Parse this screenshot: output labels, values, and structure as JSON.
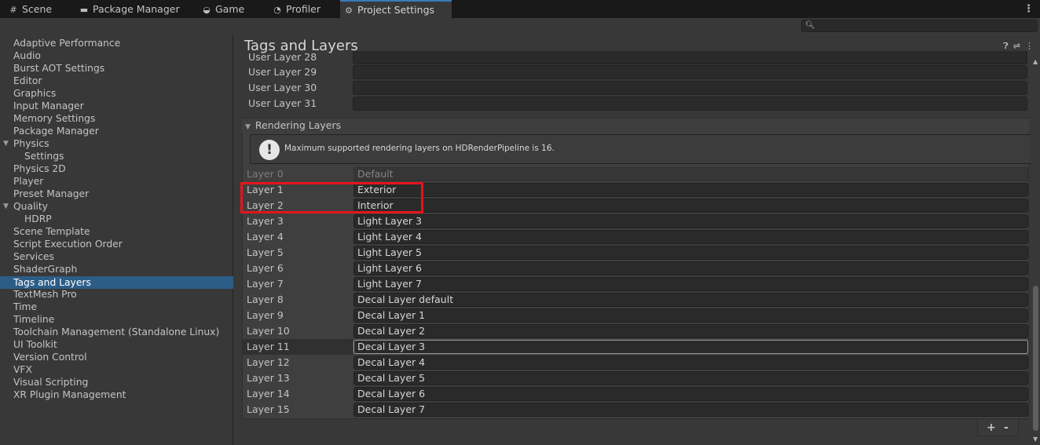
{
  "tabs": [
    {
      "label": "Scene",
      "icon": "grid-icon"
    },
    {
      "label": "Package Manager",
      "icon": "package-icon"
    },
    {
      "label": "Game",
      "icon": "gamepad-icon"
    },
    {
      "label": "Profiler",
      "icon": "profiler-icon"
    },
    {
      "label": "Project Settings",
      "icon": "gear-icon",
      "active": true
    }
  ],
  "search": {
    "placeholder": ""
  },
  "sidebar": {
    "items": [
      {
        "label": "Adaptive Performance"
      },
      {
        "label": "Audio"
      },
      {
        "label": "Burst AOT Settings"
      },
      {
        "label": "Editor"
      },
      {
        "label": "Graphics"
      },
      {
        "label": "Input Manager"
      },
      {
        "label": "Memory Settings"
      },
      {
        "label": "Package Manager"
      },
      {
        "label": "Physics"
      },
      {
        "label": "Settings"
      },
      {
        "label": "Physics 2D"
      },
      {
        "label": "Player"
      },
      {
        "label": "Preset Manager"
      },
      {
        "label": "Quality"
      },
      {
        "label": "HDRP"
      },
      {
        "label": "Scene Template"
      },
      {
        "label": "Script Execution Order"
      },
      {
        "label": "Services"
      },
      {
        "label": "ShaderGraph"
      },
      {
        "label": "Tags and Layers"
      },
      {
        "label": "TextMesh Pro"
      },
      {
        "label": "Time"
      },
      {
        "label": "Timeline"
      },
      {
        "label": "Toolchain Management (Standalone Linux)"
      },
      {
        "label": "UI Toolkit"
      },
      {
        "label": "Version Control"
      },
      {
        "label": "VFX"
      },
      {
        "label": "Visual Scripting"
      },
      {
        "label": "XR Plugin Management"
      }
    ],
    "selected": "Tags and Layers"
  },
  "main": {
    "title": "Tags and Layers",
    "user_layers": [
      {
        "label": "User Layer 28",
        "value": ""
      },
      {
        "label": "User Layer 29",
        "value": ""
      },
      {
        "label": "User Layer 30",
        "value": ""
      },
      {
        "label": "User Layer 31",
        "value": ""
      }
    ],
    "rendering_section": "Rendering Layers",
    "help_text": "Maximum supported rendering layers on HDRenderPipeline is 16.",
    "layers": [
      {
        "label": "Layer 0",
        "value": "Default"
      },
      {
        "label": "Layer 1",
        "value": "Exterior"
      },
      {
        "label": "Layer 2",
        "value": "Interior"
      },
      {
        "label": "Layer 3",
        "value": "Light Layer 3"
      },
      {
        "label": "Layer 4",
        "value": "Light Layer 4"
      },
      {
        "label": "Layer 5",
        "value": "Light Layer 5"
      },
      {
        "label": "Layer 6",
        "value": "Light Layer 6"
      },
      {
        "label": "Layer 7",
        "value": "Light Layer 7"
      },
      {
        "label": "Layer 8",
        "value": "Decal Layer default"
      },
      {
        "label": "Layer 9",
        "value": "Decal Layer 1"
      },
      {
        "label": "Layer 10",
        "value": "Decal Layer 2"
      },
      {
        "label": "Layer 11",
        "value": "Decal Layer 3"
      },
      {
        "label": "Layer 12",
        "value": "Decal Layer 4"
      },
      {
        "label": "Layer 13",
        "value": "Decal Layer 5"
      },
      {
        "label": "Layer 14",
        "value": "Decal Layer 6"
      },
      {
        "label": "Layer 15",
        "value": "Decal Layer 7"
      }
    ],
    "add_label": "+",
    "remove_label": "-"
  },
  "colors": {
    "accent": "#3a79bb",
    "selection": "#2c5d87",
    "highlight_box": "#e5141b"
  }
}
